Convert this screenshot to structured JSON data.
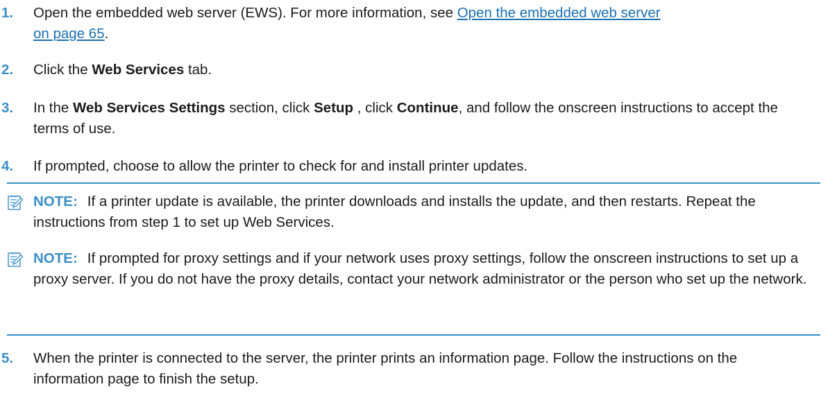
{
  "steps": [
    {
      "num": "1.",
      "text_before": "Open the embedded web server (EWS). For more information, see ",
      "link_line1": "Open the embedded web server",
      "link_line2": "on page 65",
      "text_after": "."
    },
    {
      "num": "2.",
      "pre": "Click the ",
      "bold": "Web Services",
      "post": " tab."
    },
    {
      "num": "3.",
      "pre": "In the ",
      "bold1": "Web Services Settings",
      "mid1": " section, click ",
      "bold2": "Setup",
      "mid2": " , click ",
      "bold3": "Continue",
      "post": ", and follow the onscreen instructions to accept the terms of use."
    },
    {
      "num": "4.",
      "text": "If prompted, choose to allow the printer to check for and install printer updates."
    },
    {
      "num": "5.",
      "text": "When the printer is connected to the server, the printer prints an information page. Follow the instructions on the information page to finish the setup."
    }
  ],
  "notes": [
    {
      "label": "NOTE:",
      "text": "If a printer update is available, the printer downloads and installs the update, and then restarts. Repeat the instructions from step 1 to set up Web Services."
    },
    {
      "label": "NOTE:",
      "text": "If prompted for proxy settings and if your network uses proxy settings, follow the onscreen instructions to set up a proxy server. If you do not have the proxy details, contact your network administrator or the person who set up the network."
    }
  ],
  "icons": {
    "note": "note-pencil-icon"
  },
  "colors": {
    "accent": "#3a8fc7",
    "link": "#1a6fb0"
  }
}
